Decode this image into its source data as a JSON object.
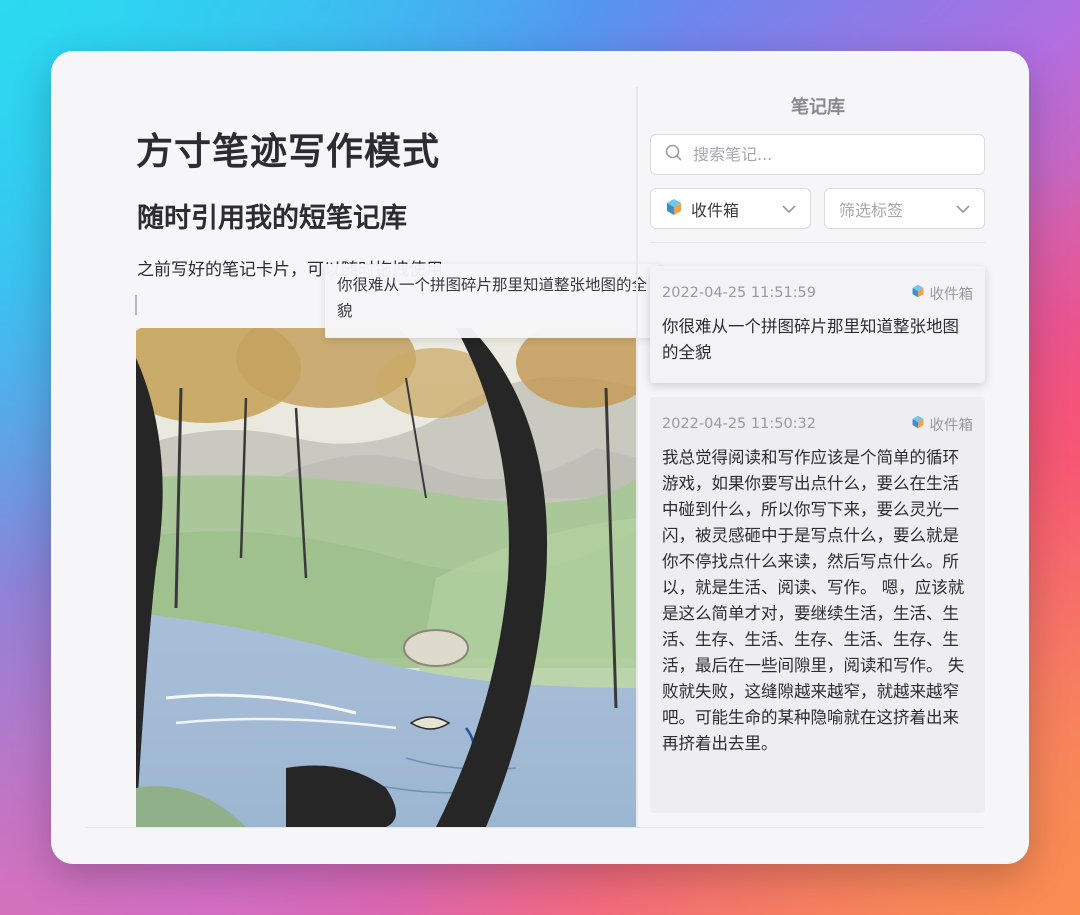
{
  "editor": {
    "title": "方寸笔迹写作模式",
    "subtitle": "随时引用我的短笔记库",
    "paragraph": "之前写好的笔记卡片，可以随时拖拽使用",
    "drag_preview": "你很难从一个拼图碎片那里知道整张地图的全貌"
  },
  "sidebar": {
    "title": "笔记库",
    "search_placeholder": "搜索笔记...",
    "inbox_filter": "收件箱",
    "tag_filter": "筛选标签"
  },
  "notes": [
    {
      "timestamp": "2022-04-25 11:51:59",
      "tag": "收件箱",
      "body": "你很难从一个拼图碎片那里知道整张地图的全貌"
    },
    {
      "timestamp": "2022-04-25 11:50:32",
      "tag": "收件箱",
      "body": "我总觉得阅读和写作应该是个简单的循环游戏，如果你要写出点什么，要么在生活中碰到什么，所以你写下来，要么灵光一闪，被灵感砸中于是写点什么，要么就是你不停找点什么来读，然后写点什么。所以，就是生活、阅读、写作。 嗯，应该就是这么简单才对，要继续生活，生活、生活、生存、生活、生存、生活、生存、生活，最后在一些间隙里，阅读和写作。 失败就失败，这缝隙越来越窄，就越来越窄吧。可能生命的某种隐喻就在这挤着出来再挤着出去里。"
    }
  ],
  "colors": {
    "window_bg": "#f6f6f8",
    "text_primary": "#2d2d2f",
    "text_muted": "#9a9a9e"
  },
  "icons": {
    "search": "search-icon",
    "inbox": "inbox-cube-icon",
    "dropdown": "chevron-down-icon"
  }
}
